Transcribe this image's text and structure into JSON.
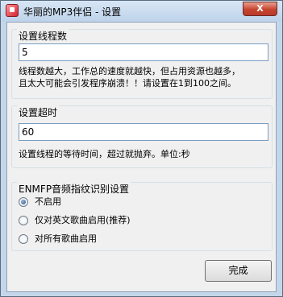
{
  "window": {
    "title": "华丽的MP3伴侣 - 设置",
    "close_label": "X"
  },
  "threads_group": {
    "title": "设置线程数",
    "value": "5",
    "description_line1": "线程数越大，工作总的速度就越快，但占用资源也越多，",
    "description_line2": "且太大可能会引发程序崩溃！！请设置在1到100之间。"
  },
  "timeout_group": {
    "title": "设置超时",
    "value": "60",
    "description": "设置线程的等待时间，超过就抛弃。单位:秒"
  },
  "enmfp_group": {
    "title": "ENMFP音频指纹识别设置",
    "options": [
      {
        "label": "不启用",
        "checked": true
      },
      {
        "label": "仅对英文歌曲启用(推荐)",
        "checked": false
      },
      {
        "label": "对所有歌曲启用",
        "checked": false
      }
    ]
  },
  "footer": {
    "done_label": "完成"
  }
}
